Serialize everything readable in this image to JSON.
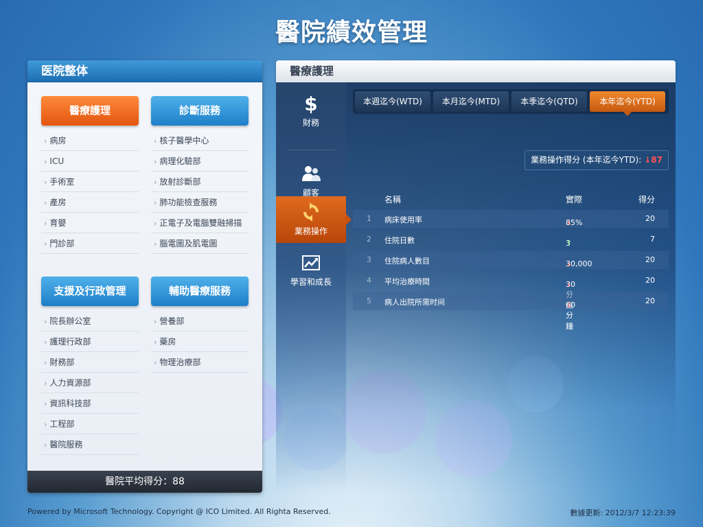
{
  "app_title": "醫院績效管理",
  "left_panel": {
    "title": "医院整体",
    "groups": [
      {
        "label": "醫療護理",
        "items": [
          "病房",
          "ICU",
          "手術室",
          "產房",
          "育嬰",
          "門診部"
        ]
      },
      {
        "label": "診斷服務",
        "items": [
          "核子醫學中心",
          "病理化驗部",
          "放射診斷部",
          "肺功能檢查服務",
          "正電子及電腦雙融掃描",
          "腦電圖及肌電圖"
        ]
      },
      {
        "label": "支援及行政管理",
        "items": [
          "院長辦公室",
          "護理行政部",
          "財務部",
          "人力資源部",
          "資訊科技部",
          "工程部",
          "醫院服務"
        ]
      },
      {
        "label": "輔助醫療服務",
        "items": [
          "營養部",
          "藥房",
          "物理治療部"
        ]
      }
    ],
    "footer": "醫院平均得分：88"
  },
  "right_panel": {
    "title": "醫療護理",
    "nav": [
      {
        "label": "財務",
        "icon": "dollar-icon"
      },
      {
        "label": "顧客",
        "icon": "customers-icon"
      },
      {
        "label": "業務操作",
        "icon": "refresh-icon"
      },
      {
        "label": "學習和成長",
        "icon": "growth-chart-icon"
      }
    ],
    "tabs": [
      "本週迄今(WTD)",
      "本月迄今(MTD)",
      "本季迄今(QTD)",
      "本年迄今(YTD)"
    ],
    "active_tab": 3,
    "score_label": "業務操作得分 (本年迄今YTD):",
    "score_value": "87",
    "score_trend": "down",
    "columns": {
      "name": "名稱",
      "actual": "實際",
      "score": "得分"
    },
    "rows": [
      {
        "num": "1",
        "name": "病床使用率",
        "actual": "85%",
        "trend": "down",
        "score": "20"
      },
      {
        "num": "2",
        "name": "住院日數",
        "actual": "3",
        "trend": "up",
        "score": "7"
      },
      {
        "num": "3",
        "name": "住院病人數目",
        "actual": "30,000",
        "trend": "down",
        "score": "20"
      },
      {
        "num": "4",
        "name": "平均治療時間",
        "actual": "30分鐘",
        "trend": "down",
        "score": "20"
      },
      {
        "num": "5",
        "name": "病人出院所需时间",
        "actual": "60分鐘",
        "trend": "down",
        "score": "20"
      }
    ]
  },
  "footer": {
    "copyright": "Powered by Microsoft Technology. Copyright @ ICO Limited. All Righta Reserved.",
    "updated": "數據更新: 2012/3/7 12:23:39"
  },
  "colors": {
    "accent_orange": "#e25510",
    "accent_blue": "#1e7fc9",
    "down_arrow": "#ff4a4a",
    "up_arrow": "#3fd24a"
  }
}
